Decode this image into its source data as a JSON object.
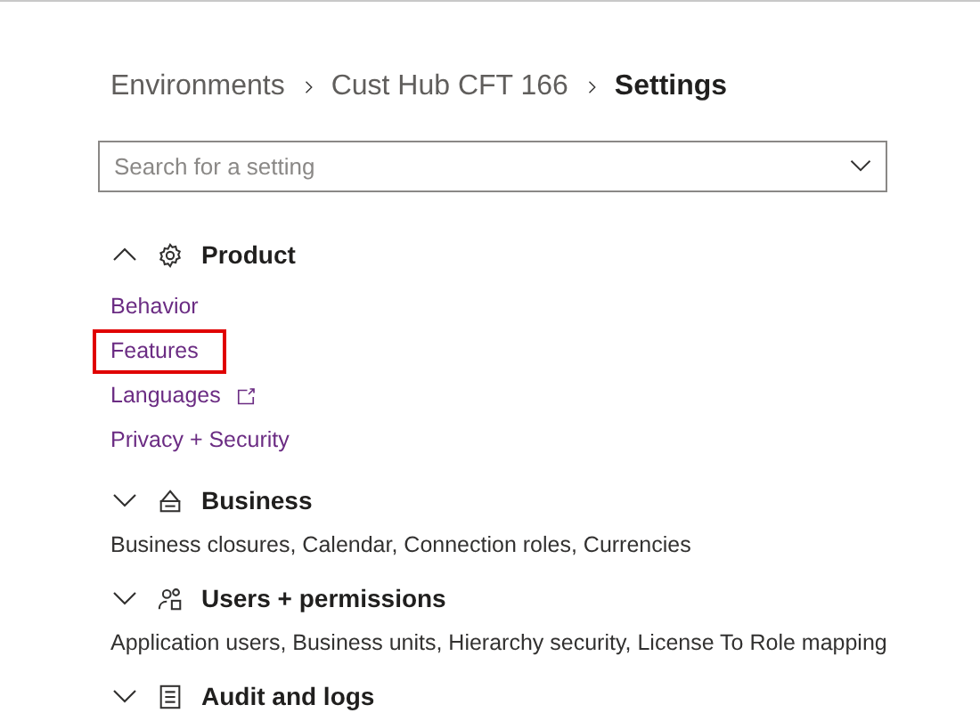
{
  "breadcrumb": [
    {
      "label": "Environments",
      "current": false
    },
    {
      "label": "Cust Hub CFT 166",
      "current": false
    },
    {
      "label": "Settings",
      "current": true
    }
  ],
  "search": {
    "placeholder": "Search for a setting"
  },
  "groups": [
    {
      "title": "Product",
      "expanded": true,
      "items": [
        {
          "label": "Behavior",
          "highlighted": false,
          "external": false
        },
        {
          "label": "Features",
          "highlighted": true,
          "external": false
        },
        {
          "label": "Languages",
          "highlighted": false,
          "external": true
        },
        {
          "label": "Privacy + Security",
          "highlighted": false,
          "external": false
        }
      ]
    },
    {
      "title": "Business",
      "expanded": false,
      "summary": "Business closures, Calendar, Connection roles, Currencies"
    },
    {
      "title": "Users + permissions",
      "expanded": false,
      "summary": "Application users, Business units, Hierarchy security, License To Role mapping"
    },
    {
      "title": "Audit and logs",
      "expanded": false
    }
  ]
}
